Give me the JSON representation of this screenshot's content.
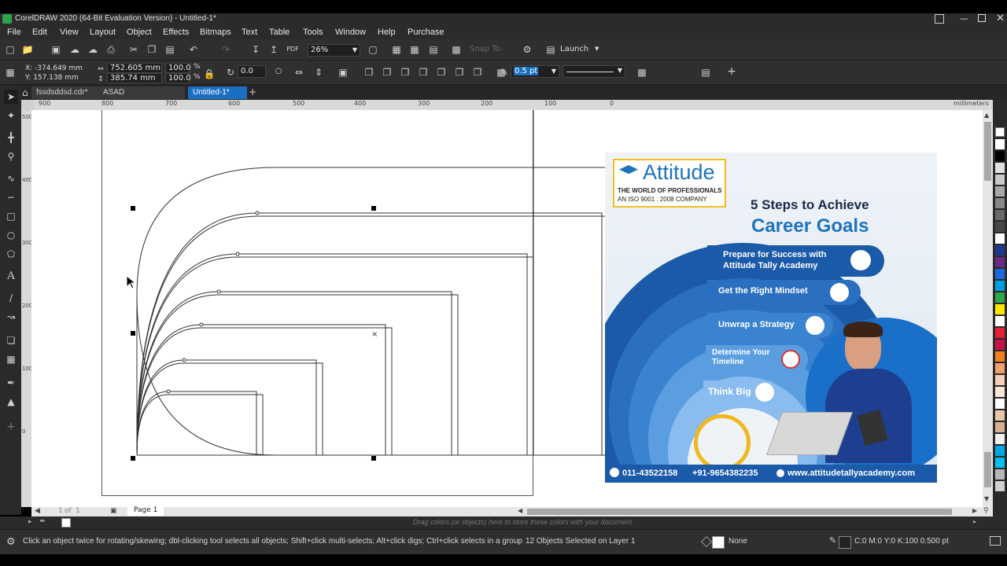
{
  "window": {
    "title": "CorelDRAW 2020 (64-Bit Evaluation Version) - Untitled-1*"
  },
  "menu": [
    "File",
    "Edit",
    "View",
    "Layout",
    "Object",
    "Effects",
    "Bitmaps",
    "Text",
    "Table",
    "Tools",
    "Window",
    "Help",
    "Purchase"
  ],
  "toolbar": {
    "zoom": "26%",
    "snap_to": "Snap To",
    "launch": "Launch"
  },
  "propbar": {
    "x": "X: -374.649 mm",
    "y": "Y: 157.138 mm",
    "width": "752.605 mm",
    "height": "385.74 mm",
    "scale_x": "100.0",
    "scale_y": "100.0",
    "pct": "%",
    "rotation": "0.0",
    "outline_width": "0.5 pt"
  },
  "tabs": [
    {
      "label": "fssdsddsd.cdr*"
    },
    {
      "label": "ASAD MOBUIELS.cdr"
    },
    {
      "label": "Untitled-1*"
    }
  ],
  "ruler": {
    "top_labels": [
      "900",
      "800",
      "700",
      "600",
      "500",
      "400",
      "300",
      "200",
      "100",
      "0"
    ],
    "units": "millimeters",
    "left_labels": [
      "500",
      "400",
      "300",
      "200",
      "100",
      "0"
    ]
  },
  "page_nav": {
    "current": "1",
    "of": "of",
    "total": "1",
    "page_tab": "Page 1"
  },
  "doc_palette_hint": "Drag colors (or objects) here to store these colors with your document",
  "status": {
    "hint": "Click an object twice for rotating/skewing; dbl-clicking tool selects all objects; Shift+click multi-selects; Alt+click digs; Ctrl+click selects in a group",
    "selection": "12 Objects Selected on Layer 1",
    "fill": "None",
    "outline": "C:0 M:0 Y:0 K:100  0.500 pt"
  },
  "poster": {
    "brand": "Attitude",
    "tagline1": "THE WORLD OF PROFESSIONALS",
    "tagline2": "AN ISO 9001 : 2008 COMPANY",
    "heading1": "5 Steps to Achieve",
    "heading2": "Career Goals",
    "steps": [
      {
        "text": "Prepare for Success with Attitude Tally Academy"
      },
      {
        "text": "Get the Right Mindset"
      },
      {
        "text": "Unwrap a Strategy"
      },
      {
        "text": "Determine Your Timeline"
      },
      {
        "text": "Think Big"
      }
    ],
    "phone": "011-43522158",
    "mobile": "+91-9654382235",
    "website": "www.attitudetallyacademy.com"
  },
  "palette_colors": [
    "#ffffff",
    "#000000",
    "#e0e0e0",
    "#c8c8c8",
    "#a8a8a8",
    "#888888",
    "#686868",
    "#484848",
    "#ffffff",
    "#1f3a8a",
    "#6a2a8a",
    "#1a6adf",
    "#00a0e0",
    "#2ea84a",
    "#ffe600",
    "#ffffff",
    "#e81f3a",
    "#c8104a",
    "#f08020",
    "#f0a070",
    "#f5d0b8",
    "#f8e8d8",
    "#ffffff",
    "#e8c8a8",
    "#d8b090",
    "#f0f0f0",
    "#00a8e8",
    "#00c0f0",
    "#b8b8b8",
    "#d0d0d0"
  ],
  "colors": {
    "accent_blue": "#1e73be",
    "poster_dark_blue": "#1a5aa8",
    "tab_active": "#1a6fc2"
  }
}
